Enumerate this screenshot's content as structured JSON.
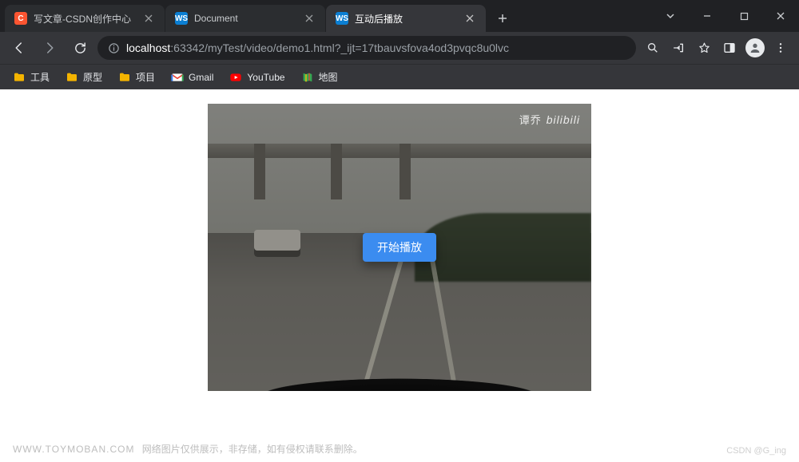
{
  "browser": {
    "tabs": [
      {
        "title": "写文章-CSDN创作中心",
        "favicon": "csdn",
        "active": false
      },
      {
        "title": "Document",
        "favicon": "ws",
        "active": false
      },
      {
        "title": "互动后播放",
        "favicon": "ws",
        "active": true
      }
    ],
    "url": {
      "host": "localhost",
      "rest": ":63342/myTest/video/demo1.html?_ijt=17tbauvsfova4od3pvqc8u0lvc"
    }
  },
  "bookmarks": [
    {
      "label": "工具",
      "icon": "folder"
    },
    {
      "label": "原型",
      "icon": "folder"
    },
    {
      "label": "项目",
      "icon": "folder"
    },
    {
      "label": "Gmail",
      "icon": "gmail"
    },
    {
      "label": "YouTube",
      "icon": "youtube"
    },
    {
      "label": "地图",
      "icon": "maps"
    }
  ],
  "video": {
    "watermark_han": "谭乔",
    "watermark_brand": "bilibili",
    "play_button_label": "开始播放"
  },
  "footer": {
    "site": "www.toymoban.com",
    "note": "网络图片仅供展示，非存储，如有侵权请联系删除。",
    "credit": "CSDN @G_ing"
  }
}
